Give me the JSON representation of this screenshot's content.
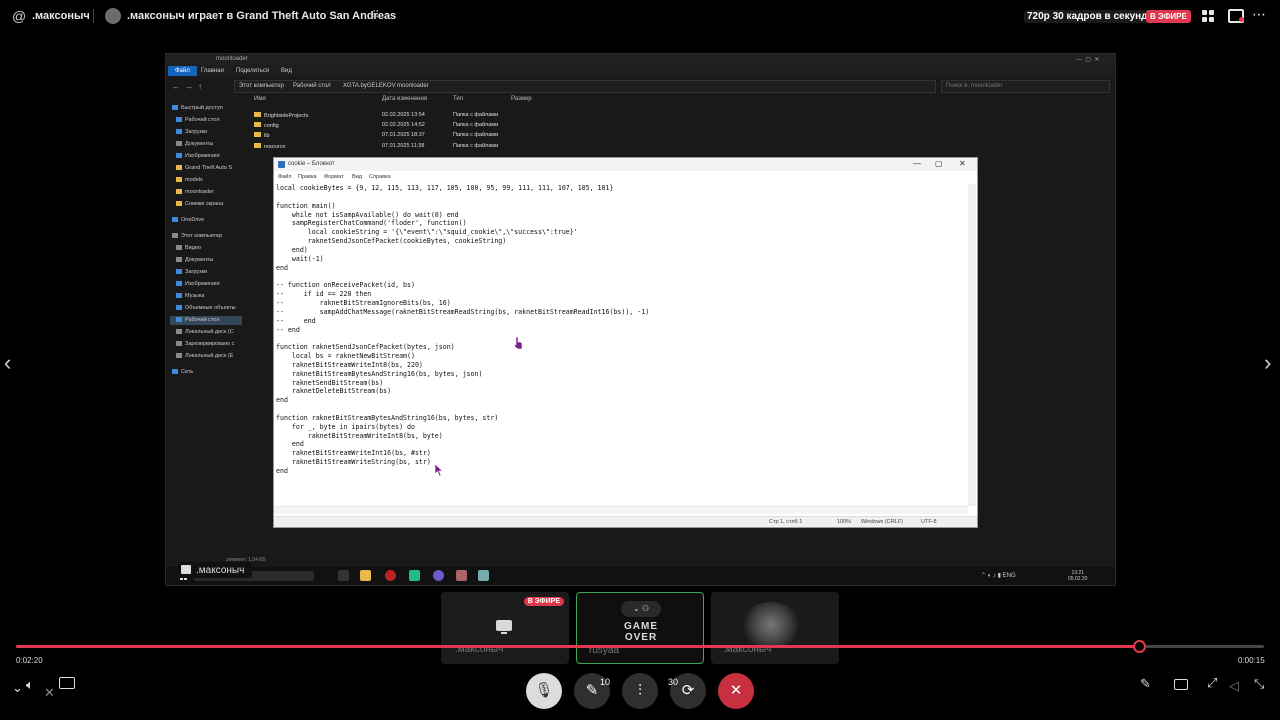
{
  "header": {
    "at_symbol": "@",
    "channel_name": ".максоныч",
    "stream_title": ".максоныч играет в Grand Theft Auto San Andreas",
    "grip": "⠿",
    "quality": "720p 30 кадров в секунду",
    "live_badge": "В ЭФИРЕ"
  },
  "explorer": {
    "title": "moonloader",
    "menu": [
      "Файл",
      "Главная",
      "Поделиться",
      "Вид"
    ],
    "address": [
      "Этот компьютер",
      "Рабочий стол",
      "XGTA.byGELEKOV",
      "moonloader"
    ],
    "search_placeholder": "Поиск в: moonloader",
    "columns": [
      "Имя",
      "Дата изменения",
      "Тип",
      "Размер"
    ],
    "sidebar": [
      "Быстрый доступ",
      "Рабочий стол",
      "Загрузки",
      "Документы",
      "Изображения",
      "Grand Theft Auto S",
      "models",
      "moonloader",
      "Снимки экрана",
      "OneDrive",
      "Этот компьютер",
      "Видео",
      "Документы",
      "Загрузки",
      "Изображения",
      "Музыка",
      "Объемные объекты",
      "Рабочий стол",
      "Локальный диск (C",
      "Зарезервировано с",
      "Локальный диск (E",
      "Сеть"
    ],
    "files": [
      {
        "name": "BrightsideProjects",
        "date": "02.02.2025 13:54",
        "type": "Папка с файлами"
      },
      {
        "name": "config",
        "date": "02.02.2025 14:52",
        "type": "Папка с файлами"
      },
      {
        "name": "lib",
        "date": "07.01.2025 18:37",
        "type": "Папка с файлами"
      },
      {
        "name": "resource",
        "date": "07.01.2025 11:38",
        "type": "Папка с файлами"
      }
    ],
    "status": "элемент: 1,04 КБ"
  },
  "taskbar": {
    "search_placeholder": "Поиск",
    "tray": "ENG",
    "time": "13:21",
    "date": "05.02.20"
  },
  "notepad": {
    "title": "cookie – Блокнот",
    "menu": [
      "Файл",
      "Правка",
      "Формат",
      "Вид",
      "Справка"
    ],
    "content": "local cookieBytes = {9, 12, 115, 113, 117, 105, 100, 95, 99, 111, 111, 107, 105, 101}\n\nfunction main()\n    while not isSampAvailable() do wait(0) end\n    sampRegisterChatCommand('floder', function()\n        local cookieString = '{\\\"event\\\":\\\"squid_cookie\\\",\\\"success\\\":true}'\n        raknetSendJsonCefPacket(cookieBytes, cookieString)\n    end)\n    wait(-1)\nend\n\n-- function onReceivePacket(id, bs)\n--     if id == 220 then\n--         raknetBitStreamIgnoreBits(bs, 16)\n--         sampAddChatMessage(raknetBitStreamReadString(bs, raknetBitStreamReadInt16(bs)), -1)\n--     end\n-- end\n\nfunction raknetSendJsonCefPacket(bytes, json)\n    local bs = raknetNewBitStream()\n    raknetBitStreamWriteInt8(bs, 220)\n    raknetBitStreamBytesAndString16(bs, bytes, json)\n    raknetSendBitStream(bs)\n    raknetDeleteBitStream(bs)\nend\n\nfunction raknetBitStreamBytesAndString16(bs, bytes, str)\n    for _, byte in ipairs(bytes) do\n        raknetBitStreamWriteInt8(bs, byte)\n    end\n    raknetBitStreamWriteInt16(bs, #str)\n    raknetBitStreamWriteString(bs, str)\nend",
    "status_pos": "Стр 1, стлб 1",
    "status_zoom": "100%",
    "status_eol": "Windows (CRLF)",
    "status_enc": "UTF-8"
  },
  "participants": [
    {
      "name": ".максоныч",
      "live": "В ЭФИРЕ"
    },
    {
      "name": "rusyaa",
      "overlay": "GAME OVER"
    },
    {
      "name": ".максоныч"
    }
  ],
  "playback": {
    "elapsed": "0:02:20",
    "remaining": "0:00:15",
    "progress_fraction": 0.9
  },
  "controls": {
    "skip_back": "10",
    "skip_forward": "30"
  }
}
